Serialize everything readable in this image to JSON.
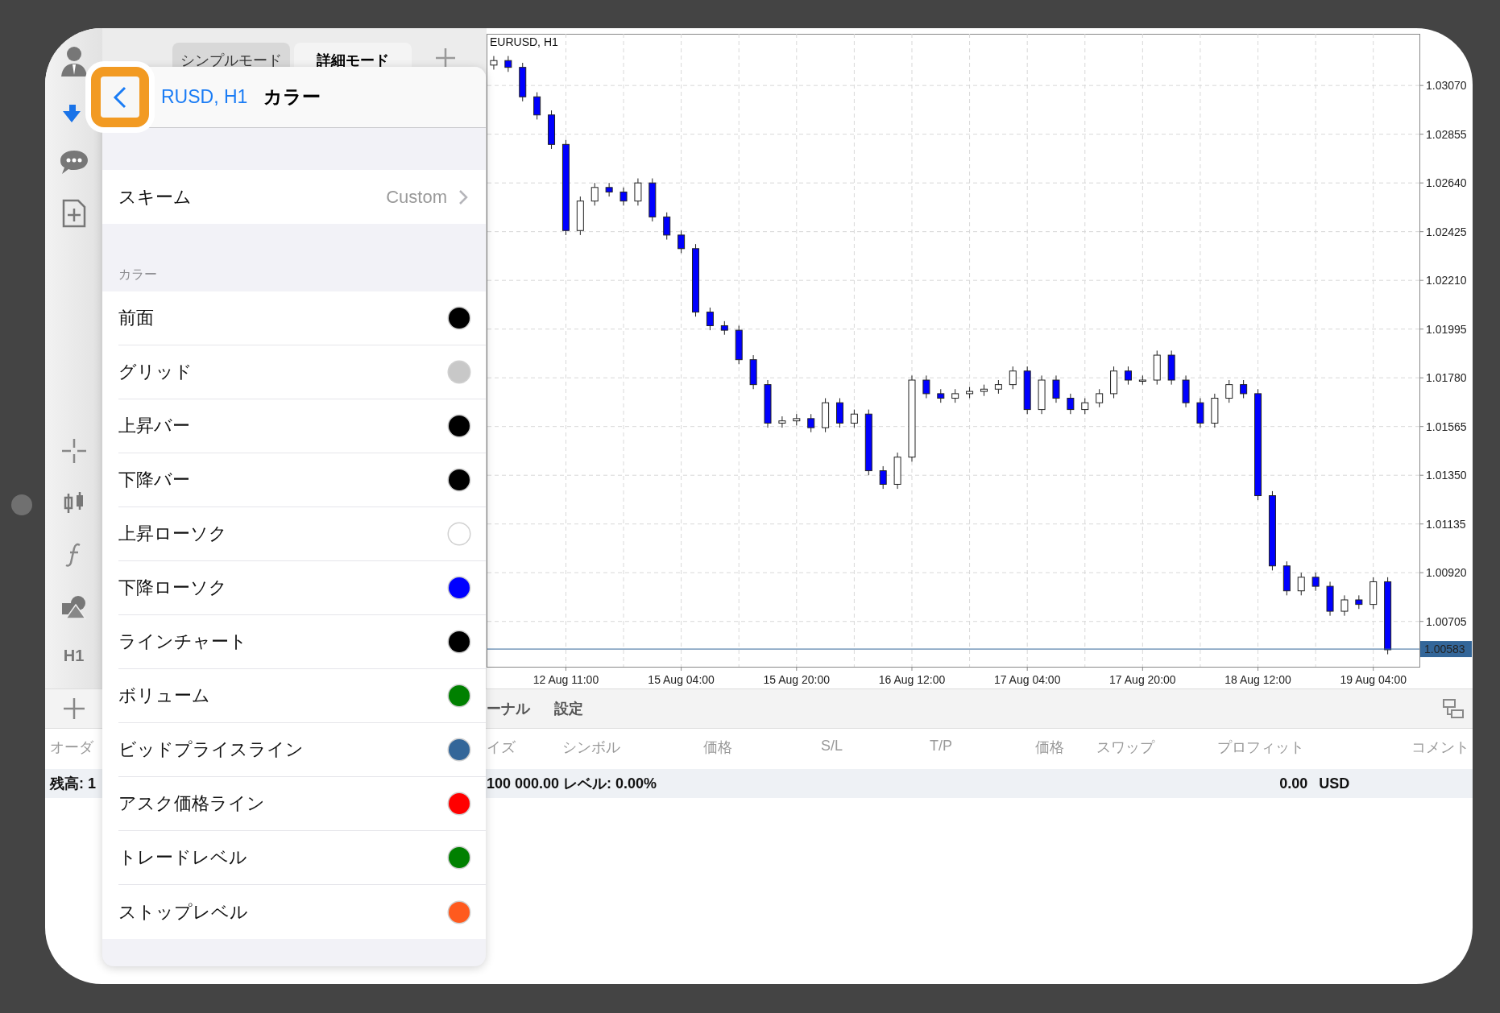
{
  "toolbar": {
    "timeframe": "H1"
  },
  "tabs": [
    {
      "label": "シンプルモード",
      "selected": false
    },
    {
      "label": "詳細モード",
      "selected": true
    }
  ],
  "popover": {
    "back_label": "RUSD, H1",
    "title": "カラー",
    "scheme": {
      "label": "スキーム",
      "value": "Custom"
    },
    "section": "カラー",
    "colors": [
      {
        "label": "前面",
        "color": "#000000"
      },
      {
        "label": "グリッド",
        "color": "#c8c8c8"
      },
      {
        "label": "上昇バー",
        "color": "#000000"
      },
      {
        "label": "下降バー",
        "color": "#000000"
      },
      {
        "label": "上昇ローソク",
        "color": "#ffffff"
      },
      {
        "label": "下降ローソク",
        "color": "#0000ff"
      },
      {
        "label": "ラインチャート",
        "color": "#000000"
      },
      {
        "label": "ボリューム",
        "color": "#008000"
      },
      {
        "label": "ビッドプライスライン",
        "color": "#336699"
      },
      {
        "label": "アスク価格ライン",
        "color": "#ff0000"
      },
      {
        "label": "トレードレベル",
        "color": "#008000"
      },
      {
        "label": "ストップレベル",
        "color": "#ff5a1e"
      }
    ]
  },
  "chart": {
    "chart_data": {
      "type": "candlestick",
      "title": "EURUSD, H1",
      "grid": true,
      "ylim": [
        1.00505,
        1.03298
      ],
      "categories": [
        null,
        null,
        null,
        null,
        null,
        "12 Aug 11:00",
        null,
        null,
        null,
        null,
        null,
        null,
        null,
        "15 Aug 04:00",
        null,
        null,
        null,
        null,
        null,
        null,
        null,
        "15 Aug 20:00",
        null,
        null,
        null,
        null,
        null,
        null,
        null,
        "16 Aug 12:00",
        null,
        null,
        null,
        null,
        null,
        null,
        null,
        "17 Aug 04:00",
        null,
        null,
        null,
        null,
        null,
        null,
        null,
        "17 Aug 20:00",
        null,
        null,
        null,
        null,
        null,
        null,
        null,
        "18 Aug 12:00",
        null,
        null,
        null,
        null,
        null,
        null,
        null,
        "19 Aug 04:00",
        null
      ],
      "yticks": [
        {
          "value": 1.0307,
          "label": "1.03070"
        },
        {
          "value": 1.02855,
          "label": "1.02855"
        },
        {
          "value": 1.0264,
          "label": "1.02640"
        },
        {
          "value": 1.02425,
          "label": "1.02425"
        },
        {
          "value": 1.0221,
          "label": "1.02210"
        },
        {
          "value": 1.01995,
          "label": "1.01995"
        },
        {
          "value": 1.0178,
          "label": "1.01780"
        },
        {
          "value": 1.01565,
          "label": "1.01565"
        },
        {
          "value": 1.0135,
          "label": "1.01350"
        },
        {
          "value": 1.01135,
          "label": "1.01135"
        },
        {
          "value": 1.0092,
          "label": "1.00920"
        },
        {
          "value": 1.00705,
          "label": "1.00705"
        }
      ],
      "ohlc": [
        [
          1.0316,
          1.032,
          1.0314,
          1.0318
        ],
        [
          1.0318,
          1.032,
          1.0313,
          1.0315
        ],
        [
          1.0315,
          1.0317,
          1.03,
          1.0302
        ],
        [
          1.0302,
          1.0304,
          1.0292,
          1.0294
        ],
        [
          1.0294,
          1.0296,
          1.0279,
          1.0281
        ],
        [
          1.0281,
          1.0283,
          1.0241,
          1.0243
        ],
        [
          1.0243,
          1.0258,
          1.0241,
          1.0256
        ],
        [
          1.0256,
          1.0264,
          1.0254,
          1.0262
        ],
        [
          1.0262,
          1.0264,
          1.0258,
          1.026
        ],
        [
          1.026,
          1.0262,
          1.0254,
          1.0256
        ],
        [
          1.0256,
          1.0266,
          1.0254,
          1.0264
        ],
        [
          1.0264,
          1.0266,
          1.0247,
          1.0249
        ],
        [
          1.0249,
          1.0251,
          1.0239,
          1.0241
        ],
        [
          1.0241,
          1.0243,
          1.0233,
          1.0235
        ],
        [
          1.0235,
          1.0237,
          1.0205,
          1.0207
        ],
        [
          1.0207,
          1.0209,
          1.0199,
          1.0201
        ],
        [
          1.0201,
          1.0203,
          1.0197,
          1.0199
        ],
        [
          1.0199,
          1.0201,
          1.0184,
          1.0186
        ],
        [
          1.0186,
          1.0188,
          1.0173,
          1.0175
        ],
        [
          1.0175,
          1.0177,
          1.0156,
          1.0158
        ],
        [
          1.0158,
          1.0161,
          1.0156,
          1.0159
        ],
        [
          1.0159,
          1.0162,
          1.0157,
          1.016
        ],
        [
          1.016,
          1.0162,
          1.0154,
          1.0156
        ],
        [
          1.0156,
          1.0169,
          1.0154,
          1.0167
        ],
        [
          1.0167,
          1.0169,
          1.0156,
          1.0158
        ],
        [
          1.0158,
          1.0164,
          1.0156,
          1.0162
        ],
        [
          1.0162,
          1.0164,
          1.0135,
          1.0137
        ],
        [
          1.0137,
          1.0139,
          1.0129,
          1.0131
        ],
        [
          1.0131,
          1.0145,
          1.0129,
          1.0143
        ],
        [
          1.0143,
          1.0179,
          1.0141,
          1.0177
        ],
        [
          1.0177,
          1.0179,
          1.0169,
          1.0171
        ],
        [
          1.0171,
          1.0173,
          1.0167,
          1.0169
        ],
        [
          1.0169,
          1.0173,
          1.0167,
          1.0171
        ],
        [
          1.0171,
          1.0174,
          1.0169,
          1.0172
        ],
        [
          1.0172,
          1.0175,
          1.017,
          1.0173
        ],
        [
          1.0173,
          1.0177,
          1.0171,
          1.0175
        ],
        [
          1.0175,
          1.0183,
          1.0173,
          1.0181
        ],
        [
          1.0181,
          1.0183,
          1.0162,
          1.0164
        ],
        [
          1.0164,
          1.0179,
          1.0162,
          1.0177
        ],
        [
          1.0177,
          1.0179,
          1.0167,
          1.0169
        ],
        [
          1.0169,
          1.0171,
          1.0162,
          1.0164
        ],
        [
          1.0164,
          1.0169,
          1.0162,
          1.0167
        ],
        [
          1.0167,
          1.0173,
          1.0165,
          1.0171
        ],
        [
          1.0171,
          1.0183,
          1.0169,
          1.0181
        ],
        [
          1.0181,
          1.0183,
          1.0175,
          1.0177
        ],
        [
          1.0177,
          1.0179,
          1.0175,
          1.0177
        ],
        [
          1.0177,
          1.019,
          1.0175,
          1.0188
        ],
        [
          1.0188,
          1.019,
          1.0175,
          1.0177
        ],
        [
          1.0177,
          1.0179,
          1.0165,
          1.0167
        ],
        [
          1.0167,
          1.0169,
          1.0156,
          1.0158
        ],
        [
          1.0158,
          1.0171,
          1.0156,
          1.0169
        ],
        [
          1.0169,
          1.0177,
          1.0167,
          1.0175
        ],
        [
          1.0175,
          1.0177,
          1.0169,
          1.0171
        ],
        [
          1.0171,
          1.0173,
          1.0124,
          1.0126
        ],
        [
          1.0126,
          1.0128,
          1.0093,
          1.0095
        ],
        [
          1.0095,
          1.0097,
          1.0082,
          1.0084
        ],
        [
          1.0084,
          1.0092,
          1.0082,
          1.009
        ],
        [
          1.009,
          1.0092,
          1.0084,
          1.0086
        ],
        [
          1.0086,
          1.0088,
          1.0073,
          1.0075
        ],
        [
          1.0075,
          1.0082,
          1.0073,
          1.008
        ],
        [
          1.008,
          1.0082,
          1.0076,
          1.0078
        ],
        [
          1.0078,
          1.009,
          1.0076,
          1.0088
        ],
        [
          1.0088,
          1.009,
          1.0056,
          1.0058
        ]
      ],
      "ref_lines": [
        {
          "axis": "y",
          "value": 1.00583,
          "label": "1.00583",
          "color": "#336699"
        }
      ]
    }
  },
  "bottom_panel": {
    "tabs": [
      "ーナル",
      "設定"
    ],
    "left_header": "オーダ",
    "left_balance": "残高: 1",
    "columns": [
      "イズ",
      "シンボル",
      "価格",
      "S/L",
      "T/P",
      "価格",
      "スワップ",
      "プロフィット",
      "コメント"
    ],
    "balance": "100 000.00 レベル: 0.00%",
    "profit": "0.00",
    "currency": "USD"
  }
}
